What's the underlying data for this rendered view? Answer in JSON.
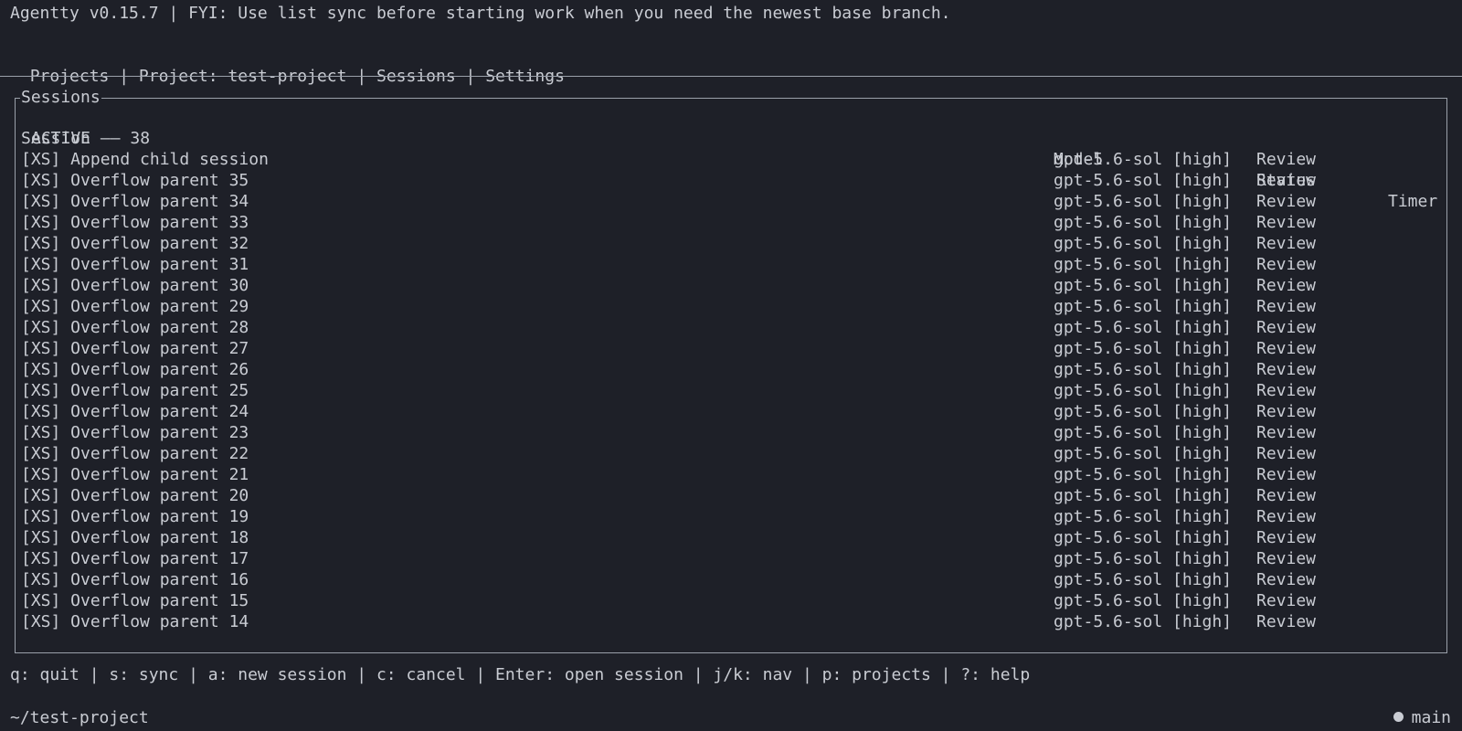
{
  "app": {
    "title": "Agentty v0.15.7 | FYI: Use list sync before starting work when you need the newest base branch."
  },
  "nav": {
    "items": [
      "Projects",
      "Project: test-project",
      "Sessions",
      "Settings"
    ],
    "separator": " | "
  },
  "panel": {
    "title": "Sessions",
    "columns": {
      "session": "Session",
      "model": "Model",
      "status": "Status",
      "timer": "Timer"
    },
    "group": {
      "label": "ACTIVE",
      "dash": "——",
      "count": "38"
    },
    "rows": [
      {
        "session": "[XS] Append child session",
        "model": "gpt-5.6-sol [high]",
        "status": "Review"
      },
      {
        "session": "[XS] Overflow parent 35",
        "model": "gpt-5.6-sol [high]",
        "status": "Review"
      },
      {
        "session": "[XS] Overflow parent 34",
        "model": "gpt-5.6-sol [high]",
        "status": "Review"
      },
      {
        "session": "[XS] Overflow parent 33",
        "model": "gpt-5.6-sol [high]",
        "status": "Review"
      },
      {
        "session": "[XS] Overflow parent 32",
        "model": "gpt-5.6-sol [high]",
        "status": "Review"
      },
      {
        "session": "[XS] Overflow parent 31",
        "model": "gpt-5.6-sol [high]",
        "status": "Review"
      },
      {
        "session": "[XS] Overflow parent 30",
        "model": "gpt-5.6-sol [high]",
        "status": "Review"
      },
      {
        "session": "[XS] Overflow parent 29",
        "model": "gpt-5.6-sol [high]",
        "status": "Review"
      },
      {
        "session": "[XS] Overflow parent 28",
        "model": "gpt-5.6-sol [high]",
        "status": "Review"
      },
      {
        "session": "[XS] Overflow parent 27",
        "model": "gpt-5.6-sol [high]",
        "status": "Review"
      },
      {
        "session": "[XS] Overflow parent 26",
        "model": "gpt-5.6-sol [high]",
        "status": "Review"
      },
      {
        "session": "[XS] Overflow parent 25",
        "model": "gpt-5.6-sol [high]",
        "status": "Review"
      },
      {
        "session": "[XS] Overflow parent 24",
        "model": "gpt-5.6-sol [high]",
        "status": "Review"
      },
      {
        "session": "[XS] Overflow parent 23",
        "model": "gpt-5.6-sol [high]",
        "status": "Review"
      },
      {
        "session": "[XS] Overflow parent 22",
        "model": "gpt-5.6-sol [high]",
        "status": "Review"
      },
      {
        "session": "[XS] Overflow parent 21",
        "model": "gpt-5.6-sol [high]",
        "status": "Review"
      },
      {
        "session": "[XS] Overflow parent 20",
        "model": "gpt-5.6-sol [high]",
        "status": "Review"
      },
      {
        "session": "[XS] Overflow parent 19",
        "model": "gpt-5.6-sol [high]",
        "status": "Review"
      },
      {
        "session": "[XS] Overflow parent 18",
        "model": "gpt-5.6-sol [high]",
        "status": "Review"
      },
      {
        "session": "[XS] Overflow parent 17",
        "model": "gpt-5.6-sol [high]",
        "status": "Review"
      },
      {
        "session": "[XS] Overflow parent 16",
        "model": "gpt-5.6-sol [high]",
        "status": "Review"
      },
      {
        "session": "[XS] Overflow parent 15",
        "model": "gpt-5.6-sol [high]",
        "status": "Review"
      },
      {
        "session": "[XS] Overflow parent 14",
        "model": "gpt-5.6-sol [high]",
        "status": "Review"
      }
    ]
  },
  "footer": {
    "keys": "q: quit | s: sync | a: new session | c: cancel | Enter: open session | j/k: nav | p: projects | ?: help",
    "path": "~/test-project",
    "branch": "main"
  },
  "colors": {
    "background": "#1e2028",
    "foreground": "#c9ccd3",
    "border": "#9aa0aa"
  },
  "icons": {
    "branch_indicator": "dot-icon"
  }
}
